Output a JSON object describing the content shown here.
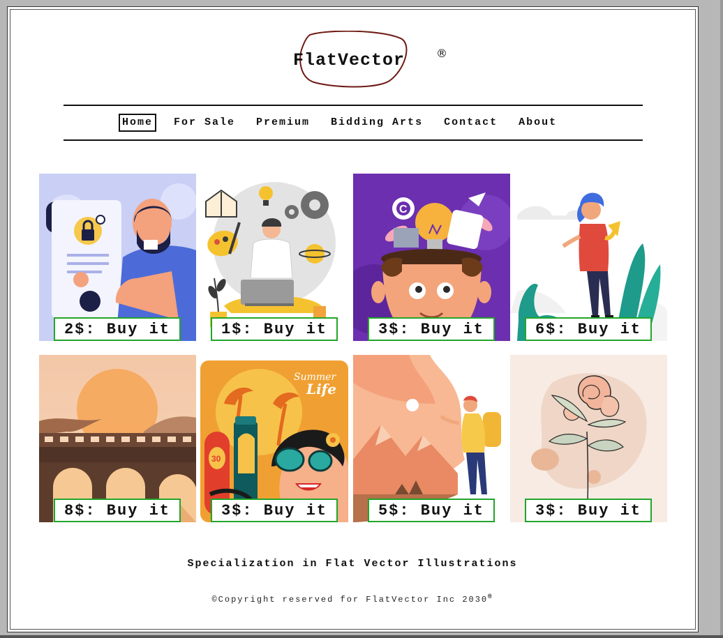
{
  "brand": {
    "name": "FlatVector",
    "reg_mark": "®",
    "annotation_color": "#6e1a14"
  },
  "nav": {
    "items": [
      {
        "label": "Home",
        "active": true
      },
      {
        "label": "For Sale",
        "active": false
      },
      {
        "label": "Premium",
        "active": false
      },
      {
        "label": "Bidding Arts",
        "active": false
      },
      {
        "label": "Contact",
        "active": false
      },
      {
        "label": "About",
        "active": false
      }
    ]
  },
  "gallery": {
    "items": [
      {
        "art": "security-document-man-icon",
        "price_label": "2$: Buy it"
      },
      {
        "art": "meditating-freelancer-laptop-icon",
        "price_label": "1$: Buy it"
      },
      {
        "art": "creative-mind-lightbulb-icon",
        "price_label": "3$: Buy it"
      },
      {
        "art": "woman-walking-plants-icon",
        "price_label": "6$: Buy it"
      },
      {
        "art": "sunset-train-bridge-icon",
        "price_label": "8$: Buy it"
      },
      {
        "art": "summer-life-beach-icon",
        "price_label": "3$: Buy it"
      },
      {
        "art": "traveler-mountains-icon",
        "price_label": "5$: Buy it"
      },
      {
        "art": "line-art-rose-icon",
        "price_label": "3$: Buy it"
      }
    ],
    "button_border_color": "#22a52b"
  },
  "footer": {
    "tagline": "Specialization in Flat Vector Illustrations",
    "copyright": "©Copyright reserved for FlatVector Inc 2030",
    "copyright_mark": "®"
  }
}
